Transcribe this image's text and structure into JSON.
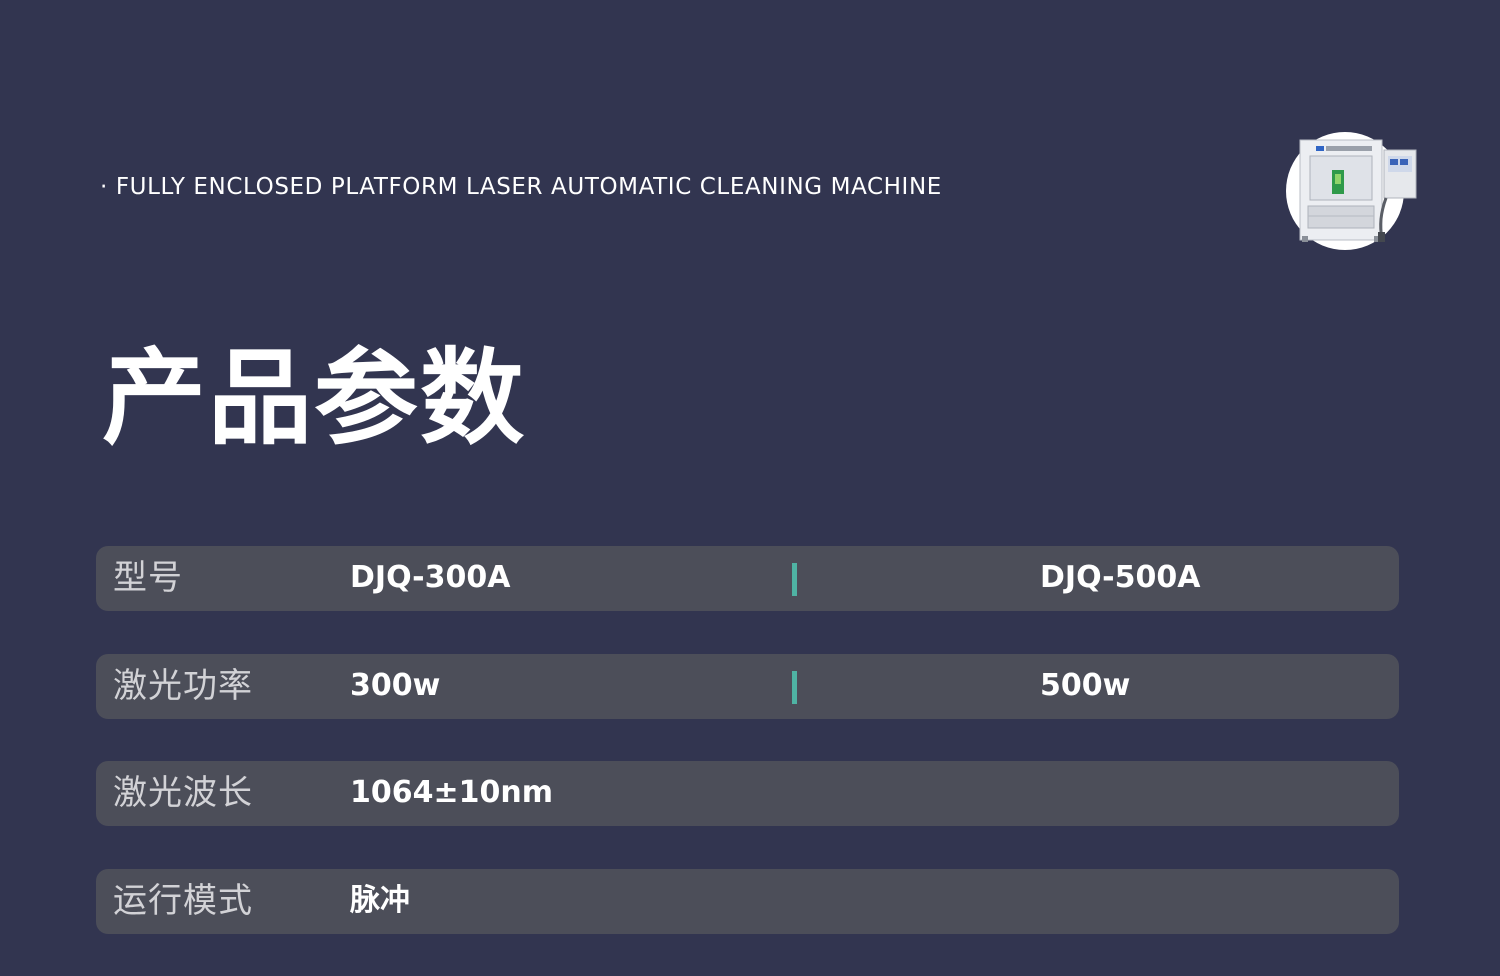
{
  "header": {
    "subtitle": "· FULLY ENCLOSED PLATFORM LASER AUTOMATIC CLEANING MACHINE",
    "title": "产品参数"
  },
  "product_image": {
    "icon": "laser-cleaning-machine-image"
  },
  "params": [
    {
      "label": "型号",
      "value_a": "DJQ-300A",
      "value_b": "DJQ-500A"
    },
    {
      "label": "激光功率",
      "value_a": "300w",
      "value_b": "500w"
    },
    {
      "label": "激光波长",
      "value_a": "1064±10nm"
    },
    {
      "label": "运行模式",
      "value_a": "脉冲"
    }
  ],
  "colors": {
    "background": "#323550",
    "row_background": "#4c4e59",
    "divider_accent": "#4fb3a4",
    "text_primary": "#ffffff",
    "text_label": "#d2d2d6"
  }
}
